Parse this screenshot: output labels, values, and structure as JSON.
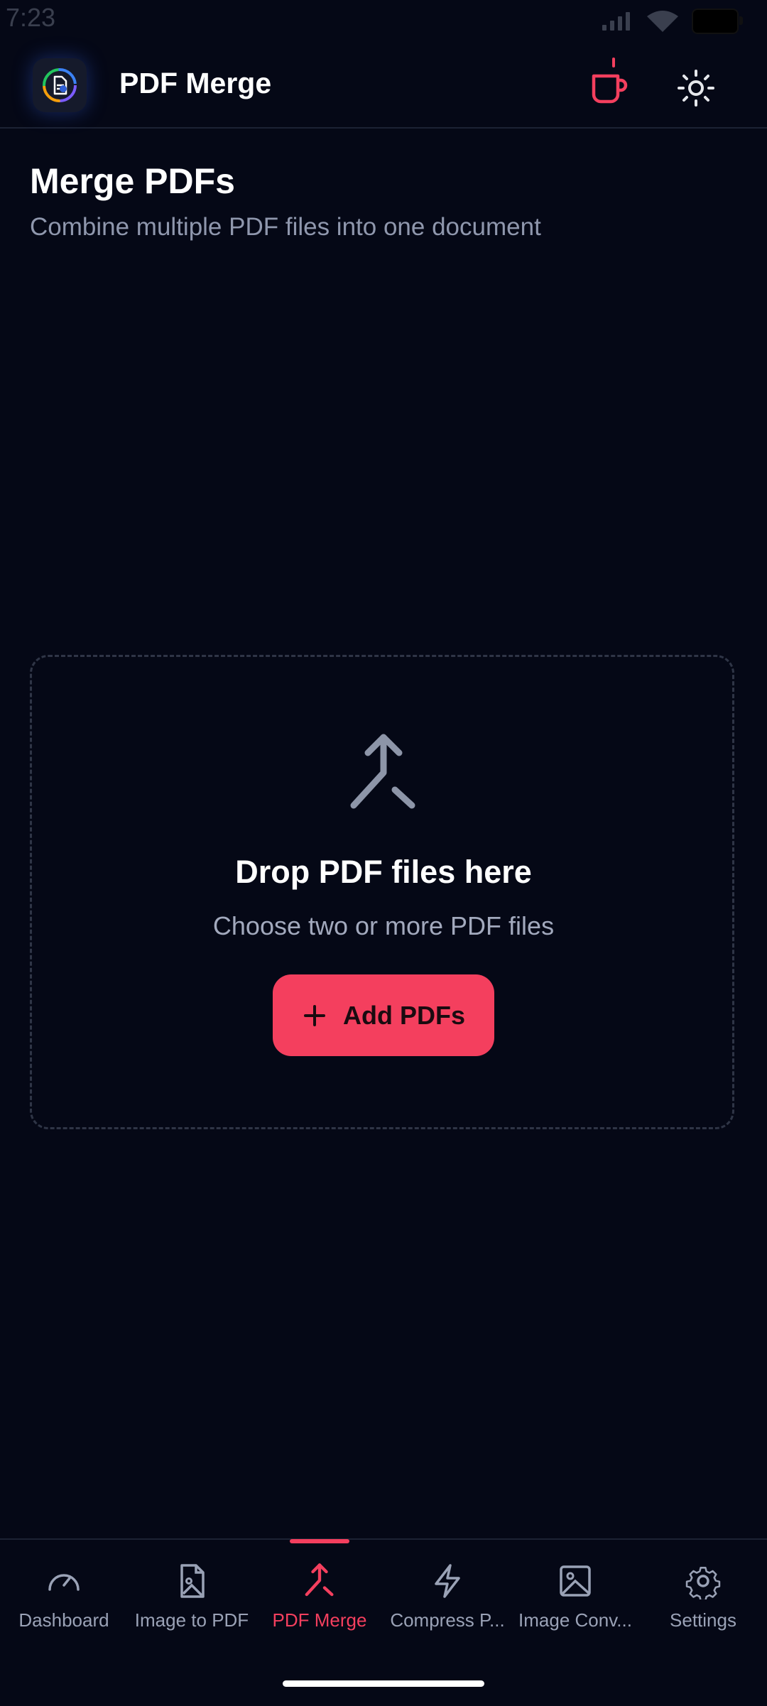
{
  "status_bar": {
    "time": "7:23"
  },
  "app_bar": {
    "title": "PDF Merge",
    "colors": {
      "accent": "#f43f5e",
      "background": "#050816"
    }
  },
  "page": {
    "title": "Merge PDFs",
    "subtitle": "Combine multiple PDF files into one document"
  },
  "drop_zone": {
    "icon": "merge-icon",
    "title": "Drop PDF files here",
    "hint": "Choose two or more PDF files",
    "add_button_label": "Add PDFs"
  },
  "bottom_nav": {
    "active_index": 2,
    "items": [
      {
        "label": "Dashboard",
        "icon": "gauge-icon"
      },
      {
        "label": "Image to PDF",
        "icon": "file-image-icon"
      },
      {
        "label": "PDF Merge",
        "icon": "merge-icon"
      },
      {
        "label": "Compress P...",
        "icon": "lightning-icon"
      },
      {
        "label": "Image Conv...",
        "icon": "image-icon"
      },
      {
        "label": "Settings",
        "icon": "gear-icon"
      }
    ]
  }
}
